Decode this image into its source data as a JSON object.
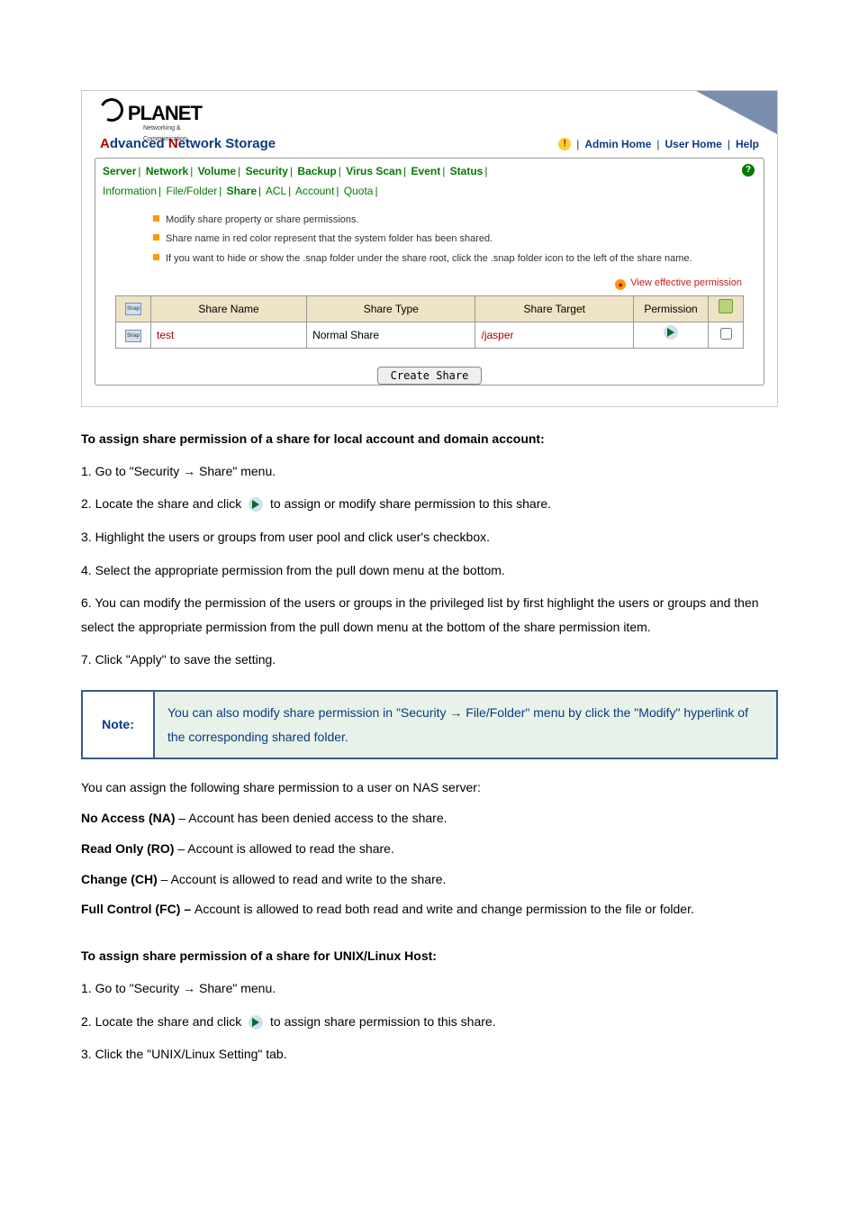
{
  "screenshot": {
    "brand_main": "PLANET",
    "brand_sub": "Networking & Communication",
    "product_title_1": "A",
    "product_title_2": "dvanced ",
    "product_title_3": "N",
    "product_title_4": "etwork Storage",
    "links": {
      "admin": "Admin Home",
      "user": "User Home",
      "help": "Help"
    },
    "tabs_top": [
      "Server",
      "Network",
      "Volume",
      "Security",
      "Backup",
      "Virus Scan",
      "Event",
      "Status"
    ],
    "tabs_sub": [
      "Information",
      "File/Folder",
      "Share",
      "ACL",
      "Account",
      "Quota"
    ],
    "hints": [
      "Modify share property or share permissions.",
      "Share name in red color represent that the system folder has been shared.",
      "If you want to hide or show the .snap folder under the share root, click the .snap folder icon to the left of the share name."
    ],
    "view_effective": "View effective permission",
    "table": {
      "headers": [
        "Share Name",
        "Share Type",
        "Share Target",
        "Permission"
      ],
      "row": {
        "name": "test",
        "type": "Normal Share",
        "target": "/jasper"
      }
    },
    "create_button": "Create Share"
  },
  "doc": {
    "h1": "To assign share permission of a share for local account and domain account:",
    "steps1": [
      "1. Go to \"Security → Share\" menu.",
      "2. Locate the share and click",
      "to assign or modify share permission to this share.",
      "3. Highlight the users or groups from user pool and click user's checkbox.",
      "4. Select the appropriate permission from the pull down menu at the bottom."
    ],
    "step6": "6. You can modify the permission of the users or groups in the privileged list by first highlight the users or groups and then select the appropriate permission from the pull down menu at the bottom of the share permission item.",
    "step7": "7. Click \"Apply\" to save the setting.",
    "note_label": "Note:",
    "note_body": "You can also modify share permission in \"Security → File/Folder\" menu by click the \"Modify\" hyperlink of the corresponding shared folder.",
    "perm_intro": "You can assign the following share permission to a user on NAS server:",
    "perms": [
      {
        "k": "No Access (NA)",
        "v": " – Account has been denied access to the share."
      },
      {
        "k": "Read Only (RO)",
        "v": " – Account is allowed to read the share."
      },
      {
        "k": "Change (CH)",
        "v": " – Account is allowed to read and write to the share."
      },
      {
        "k": "Full Control (FC) – ",
        "v": "Account is allowed to read both read and write and change permission to the file or folder."
      }
    ],
    "h2": "To assign share permission of a share for UNIX/Linux Host:",
    "steps2": [
      "1. Go to \"Security → Share\" menu.",
      "2. Locate the share and click",
      "to assign share permission to this share.",
      "3. Click the \"UNIX/Linux Setting\" tab."
    ]
  }
}
